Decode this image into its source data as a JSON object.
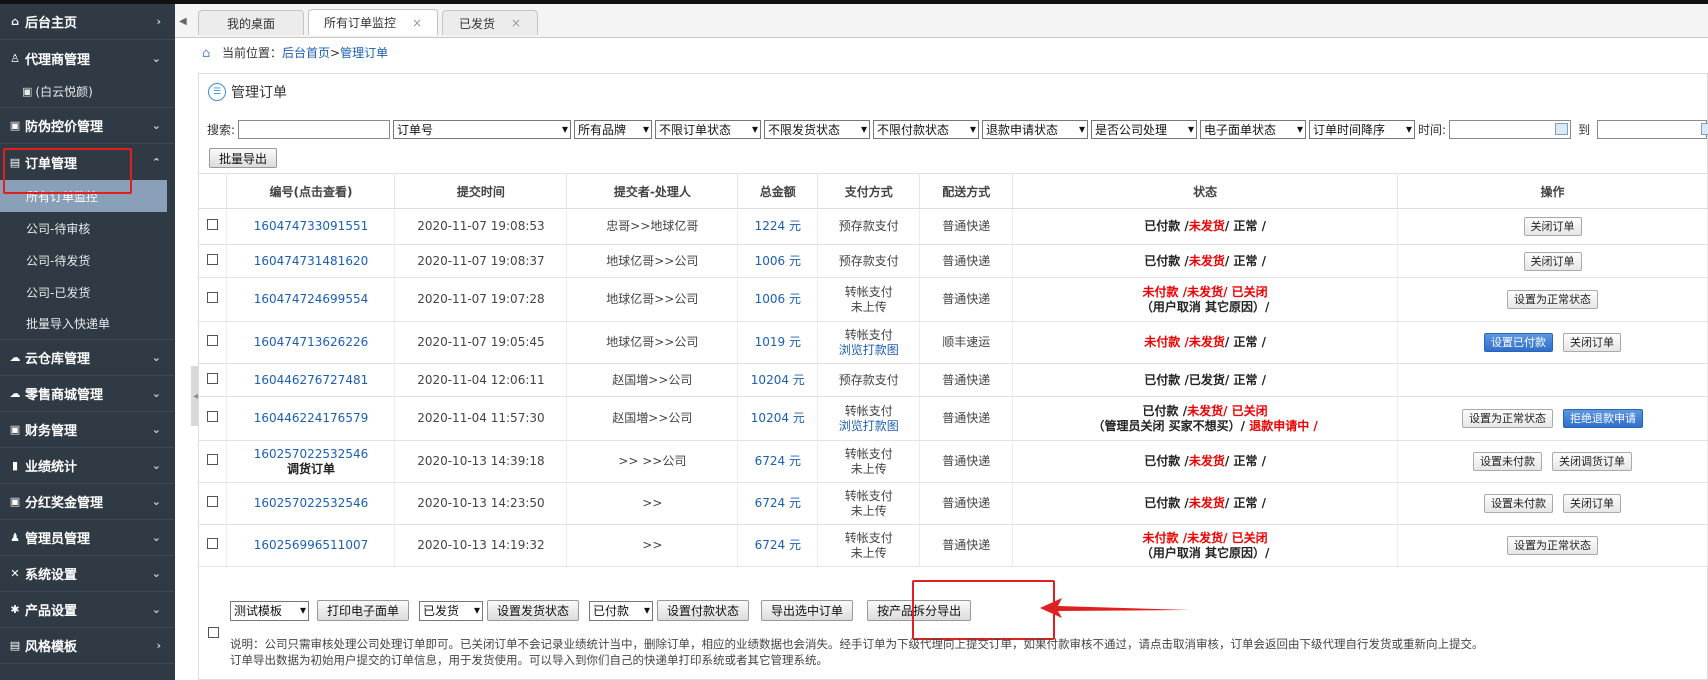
{
  "sidebar": {
    "items": [
      {
        "icon": "home-icon",
        "glyph": "⌂",
        "label": "后台主页",
        "chev": "›"
      },
      {
        "icon": "user-icon",
        "glyph": "♙",
        "label": "代理商管理",
        "chev": "⌄"
      },
      {
        "icon": "shield-icon",
        "glyph": "▣",
        "label": "防伪控价管理",
        "chev": "⌄"
      },
      {
        "icon": "document-icon",
        "glyph": "▤",
        "label": "订单管理",
        "chev": "⌃"
      },
      {
        "icon": "cloud-icon",
        "glyph": "☁",
        "label": "云仓库管理",
        "chev": "⌄"
      },
      {
        "icon": "shop-icon",
        "glyph": "☁",
        "label": "零售商城管理",
        "chev": "⌄"
      },
      {
        "icon": "finance-icon",
        "glyph": "▣",
        "label": "财务管理",
        "chev": "⌄"
      },
      {
        "icon": "chart-icon",
        "glyph": "▮",
        "label": "业绩统计",
        "chev": "⌄"
      },
      {
        "icon": "dividend-icon",
        "glyph": "▣",
        "label": "分红奖金管理",
        "chev": "⌄"
      },
      {
        "icon": "admin-icon",
        "glyph": "♟",
        "label": "管理员管理",
        "chev": "⌄"
      },
      {
        "icon": "tools-icon",
        "glyph": "✕",
        "label": "系统设置",
        "chev": "⌄"
      },
      {
        "icon": "gear-icon",
        "glyph": "✱",
        "label": "产品设置",
        "chev": "⌄"
      },
      {
        "icon": "template-icon",
        "glyph": "▤",
        "label": "风格模板",
        "chev": "›"
      }
    ],
    "agent_sub": {
      "glyph": "▣",
      "label": "(白云悦颜)"
    },
    "order_sub": [
      "所有订单监控",
      "公司-待审核",
      "公司-待发货",
      "公司-已发货",
      "批量导入快递单"
    ]
  },
  "tabs": [
    {
      "label": "我的桌面",
      "closable": false
    },
    {
      "label": "所有订单监控",
      "closable": true
    },
    {
      "label": "已发货",
      "closable": true
    }
  ],
  "tab_close": "×",
  "breadcrumb": {
    "prefix": "当前位置：",
    "home": "后台首页",
    "sep": " > ",
    "current": "管理订单"
  },
  "panel": {
    "icon_glyph": "☰",
    "title": "管理订单"
  },
  "filter": {
    "search_label": "搜索:",
    "search_value": "",
    "field_select": "订单号",
    "brand": "所有品牌",
    "order_status": "不限订单状态",
    "ship_status": "不限发货状态",
    "pay_status": "不限付款状态",
    "refund_status": "退款申请状态",
    "company_handle": "是否公司处理",
    "eform_status": "电子面单状态",
    "sort": "订单时间降序",
    "time_label": "时间:",
    "to_label": "到",
    "batch_export": "批量导出"
  },
  "table": {
    "headers": [
      "编号(点击查看)",
      "提交时间",
      "提交者-处理人",
      "总金额",
      "支付方式",
      "配送方式",
      "状态",
      "操作"
    ],
    "rows": [
      {
        "id": "160474733091551",
        "sub": "",
        "time": "2020-11-07 19:08:53",
        "who": "忠哥>>地球亿哥",
        "amount": "1224 元",
        "pay": "预存款支付",
        "pay2": "",
        "pay2_link": false,
        "ship": "普通快递",
        "status": [
          [
            {
              "t": "已付款 /",
              "c": "blk"
            },
            {
              "t": "未发货",
              "c": "red"
            },
            {
              "t": "/ 正常 /",
              "c": "blk"
            }
          ]
        ],
        "ops": [
          {
            "label": "关闭订单",
            "style": "sm"
          }
        ]
      },
      {
        "id": "160474731481620",
        "sub": "",
        "time": "2020-11-07 19:08:37",
        "who": "地球亿哥>>公司",
        "amount": "1006 元",
        "pay": "预存款支付",
        "pay2": "",
        "pay2_link": false,
        "ship": "普通快递",
        "status": [
          [
            {
              "t": "已付款 /",
              "c": "blk"
            },
            {
              "t": "未发货",
              "c": "red"
            },
            {
              "t": "/ 正常 /",
              "c": "blk"
            }
          ]
        ],
        "ops": [
          {
            "label": "关闭订单",
            "style": "sm"
          }
        ]
      },
      {
        "id": "160474724699554",
        "sub": "",
        "time": "2020-11-07 19:07:28",
        "who": "地球亿哥>>公司",
        "amount": "1006 元",
        "pay": "转帐支付",
        "pay2": "未上传",
        "pay2_link": false,
        "ship": "普通快递",
        "status": [
          [
            {
              "t": "未付款 /未发货/ 已关闭",
              "c": "red"
            }
          ],
          [
            {
              "t": "（用户取消 其它原因）/",
              "c": "blk"
            }
          ]
        ],
        "ops": [
          {
            "label": "设置为正常状态",
            "style": "sm"
          }
        ]
      },
      {
        "id": "160474713626226",
        "sub": "",
        "time": "2020-11-07 19:05:45",
        "who": "地球亿哥>>公司",
        "amount": "1019 元",
        "pay": "转帐支付",
        "pay2": "浏览打款图",
        "pay2_link": true,
        "ship": "顺丰速运",
        "status": [
          [
            {
              "t": "未付款 /未发货",
              "c": "red"
            },
            {
              "t": "/ 正常 /",
              "c": "blk"
            }
          ]
        ],
        "ops": [
          {
            "label": "设置已付款",
            "style": "blue"
          },
          {
            "label": "关闭订单",
            "style": "sm"
          }
        ]
      },
      {
        "id": "160446276727481",
        "sub": "",
        "time": "2020-11-04 12:06:11",
        "who": "赵国増>>公司",
        "amount": "10204 元",
        "pay": "预存款支付",
        "pay2": "",
        "pay2_link": false,
        "ship": "普通快递",
        "status": [
          [
            {
              "t": "已付款 /已发货/ 正常 /",
              "c": "blk"
            }
          ]
        ],
        "ops": []
      },
      {
        "id": "160446224176579",
        "sub": "",
        "time": "2020-11-04 11:57:30",
        "who": "赵国増>>公司",
        "amount": "10204 元",
        "pay": "转帐支付",
        "pay2": "浏览打款图",
        "pay2_link": true,
        "ship": "普通快递",
        "status": [
          [
            {
              "t": "已付款 /",
              "c": "blk"
            },
            {
              "t": "未发货/ 已关闭",
              "c": "red"
            }
          ],
          [
            {
              "t": "（管理员关闭 买家不想买）/",
              "c": "blk"
            },
            {
              "t": " 退款申请中 /",
              "c": "red"
            }
          ]
        ],
        "ops": [
          {
            "label": "设置为正常状态",
            "style": "sm"
          },
          {
            "label": "拒绝退款申请",
            "style": "blue"
          }
        ]
      },
      {
        "id": "160257022532546",
        "sub": "调货订单",
        "time": "2020-10-13 14:39:18",
        "who": ">> >>公司",
        "amount": "6724 元",
        "pay": "转帐支付",
        "pay2": "未上传",
        "pay2_link": false,
        "ship": "普通快递",
        "status": [
          [
            {
              "t": "已付款 /",
              "c": "blk"
            },
            {
              "t": "未发货",
              "c": "red"
            },
            {
              "t": "/ 正常 /",
              "c": "blk"
            }
          ]
        ],
        "ops": [
          {
            "label": "设置未付款",
            "style": "sm"
          },
          {
            "label": "关闭调货订单",
            "style": "sm"
          }
        ]
      },
      {
        "id": "160257022532546",
        "sub": "",
        "time": "2020-10-13 14:23:50",
        "who": ">>",
        "amount": "6724 元",
        "pay": "转帐支付",
        "pay2": "未上传",
        "pay2_link": false,
        "ship": "普通快递",
        "status": [
          [
            {
              "t": "已付款 /",
              "c": "blk"
            },
            {
              "t": "未发货",
              "c": "red"
            },
            {
              "t": "/ 正常 /",
              "c": "blk"
            }
          ]
        ],
        "ops": [
          {
            "label": "设置未付款",
            "style": "sm"
          },
          {
            "label": "关闭订单",
            "style": "sm"
          }
        ]
      },
      {
        "id": "160256996511007",
        "sub": "",
        "time": "2020-10-13 14:19:32",
        "who": ">>",
        "amount": "6724 元",
        "pay": "转帐支付",
        "pay2": "未上传",
        "pay2_link": false,
        "ship": "普通快递",
        "status": [
          [
            {
              "t": "未付款 /未发货/ 已关闭",
              "c": "red"
            }
          ],
          [
            {
              "t": "（用户取消 其它原因）/",
              "c": "blk"
            }
          ]
        ],
        "ops": [
          {
            "label": "设置为正常状态",
            "style": "sm"
          }
        ]
      }
    ]
  },
  "bottom": {
    "template_select": "测试模板",
    "print_eform": "打印电子面单",
    "ship_select": "已发货",
    "set_ship_status": "设置发货状态",
    "pay_select": "已付款",
    "set_pay_status": "设置付款状态",
    "export_selected": "导出选中订单",
    "split_export": "按产品拆分导出",
    "note_line1": "说明：公司只需审核处理公司处理订单即可。已关闭订单不会记录业绩统计当中，删除订单，相应的业绩数据也会消失。经手订单为下级代理向上提交订单，如果付款审核不通过，请点击取消审核，订单会返回由下级代理自行发货或重新向上提交。",
    "note_line2": "订单导出数据为初始用户提交的订单信息，用于发货使用。可以导入到你们自己的快递单打印系统或者其它管理系统。"
  },
  "colors": {
    "sidebar_bg": "#2f3a45",
    "active_sub": "#8aa0b8",
    "highlight_red": "#e02020",
    "link_blue": "#1a5fb4"
  }
}
